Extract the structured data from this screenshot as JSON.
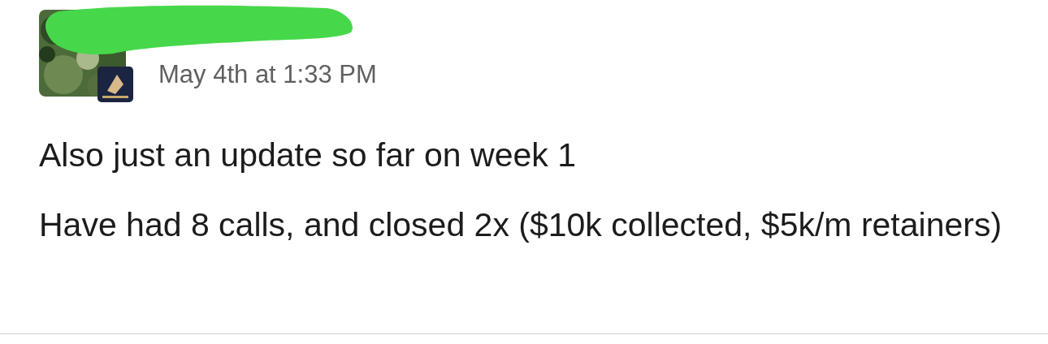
{
  "message": {
    "timestamp": "May 4th at 1:33 PM",
    "paragraphs": [
      "Also just an update so far on week 1",
      "Have had 8 calls, and closed 2x ($10k collected, $5k/m retainers)"
    ]
  }
}
